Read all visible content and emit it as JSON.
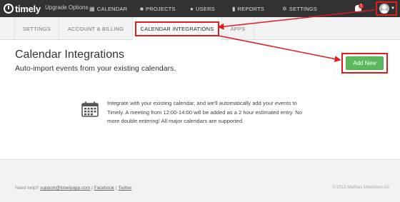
{
  "app": {
    "logo_text": "timely",
    "plan_text": "Upgrade Options"
  },
  "nav": {
    "calendar": "CALENDAR",
    "projects": "PROJECTS",
    "users": "USERS",
    "reports": "REPORTS",
    "settings": "SETTINGS"
  },
  "notifications": {
    "count": "1"
  },
  "tabs": {
    "settings": "SETTINGS",
    "account_billing": "ACCOUNT & BILLING",
    "calendar_integrations": "CALENDAR INTEGRATIONS",
    "apps": "APPS"
  },
  "page": {
    "title": "Calendar Integrations",
    "subtitle": "Auto-import events from your existing calendars.",
    "add_new_label": "Add New"
  },
  "info": {
    "text": "Integrate with your existing calendar, and we'll automatically add your events to Timely. A meeting from 12:00-14:00 will be added as a 2 hour estimated entry. No more double entering! All major calendars are supported."
  },
  "footer": {
    "help_text": "Need help?",
    "support_email": "support@timelyapp.com",
    "facebook": "Facebook",
    "twitter": "Twitter",
    "separator": "|",
    "copyright": "© 2015 Mathias Mikkelsen AS"
  },
  "colors": {
    "topbar": "#323232",
    "accent_green": "#5cb85c",
    "annotation_red": "#e21b1b"
  }
}
